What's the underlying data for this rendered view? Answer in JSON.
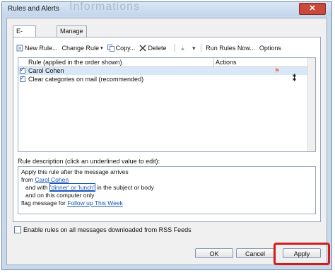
{
  "window": {
    "title": "Rules and Alerts",
    "ghost_text": "Informations",
    "close_glyph": "✕"
  },
  "tabs": [
    {
      "label": "E-mail Rules"
    },
    {
      "label": "Manage Alerts"
    }
  ],
  "toolbar": {
    "new_rule": "New Rule...",
    "change_rule": "Change Rule",
    "copy": "Copy...",
    "delete": "Delete",
    "run_rules_now": "Run Rules Now...",
    "options": "Options"
  },
  "rules_list": {
    "headers": {
      "rule": "Rule (applied in the order shown)",
      "actions": "Actions"
    },
    "rows": [
      {
        "name": "Carol Cohen",
        "checked": true,
        "selected": true,
        "action_icon": "flag-icon"
      },
      {
        "name": "Clear categories on mail (recommended)",
        "checked": true,
        "selected": false,
        "action_icon": "clear-categories-icon"
      }
    ]
  },
  "description": {
    "label": "Rule description (click an underlined value to edit):",
    "line1": "Apply this rule after the message arrives",
    "line2_prefix": "from ",
    "line2_link": "Carol Cohen",
    "line3_prefix": "and with ",
    "line3_link": "'dinner' or 'lunch'",
    "line3_suffix": " in the subject or body",
    "line4": "and on this computer only",
    "line5_prefix": "flag message for ",
    "line5_link": "Follow up This Week"
  },
  "rss_checkbox": {
    "label": "Enable rules on all messages downloaded from RSS Feeds",
    "checked": false
  },
  "buttons": {
    "ok": "OK",
    "cancel": "Cancel",
    "apply": "Apply"
  },
  "colors": {
    "highlight": "#d41c1c",
    "link": "#1a55b8",
    "titlebar": "#c3d5ea"
  }
}
